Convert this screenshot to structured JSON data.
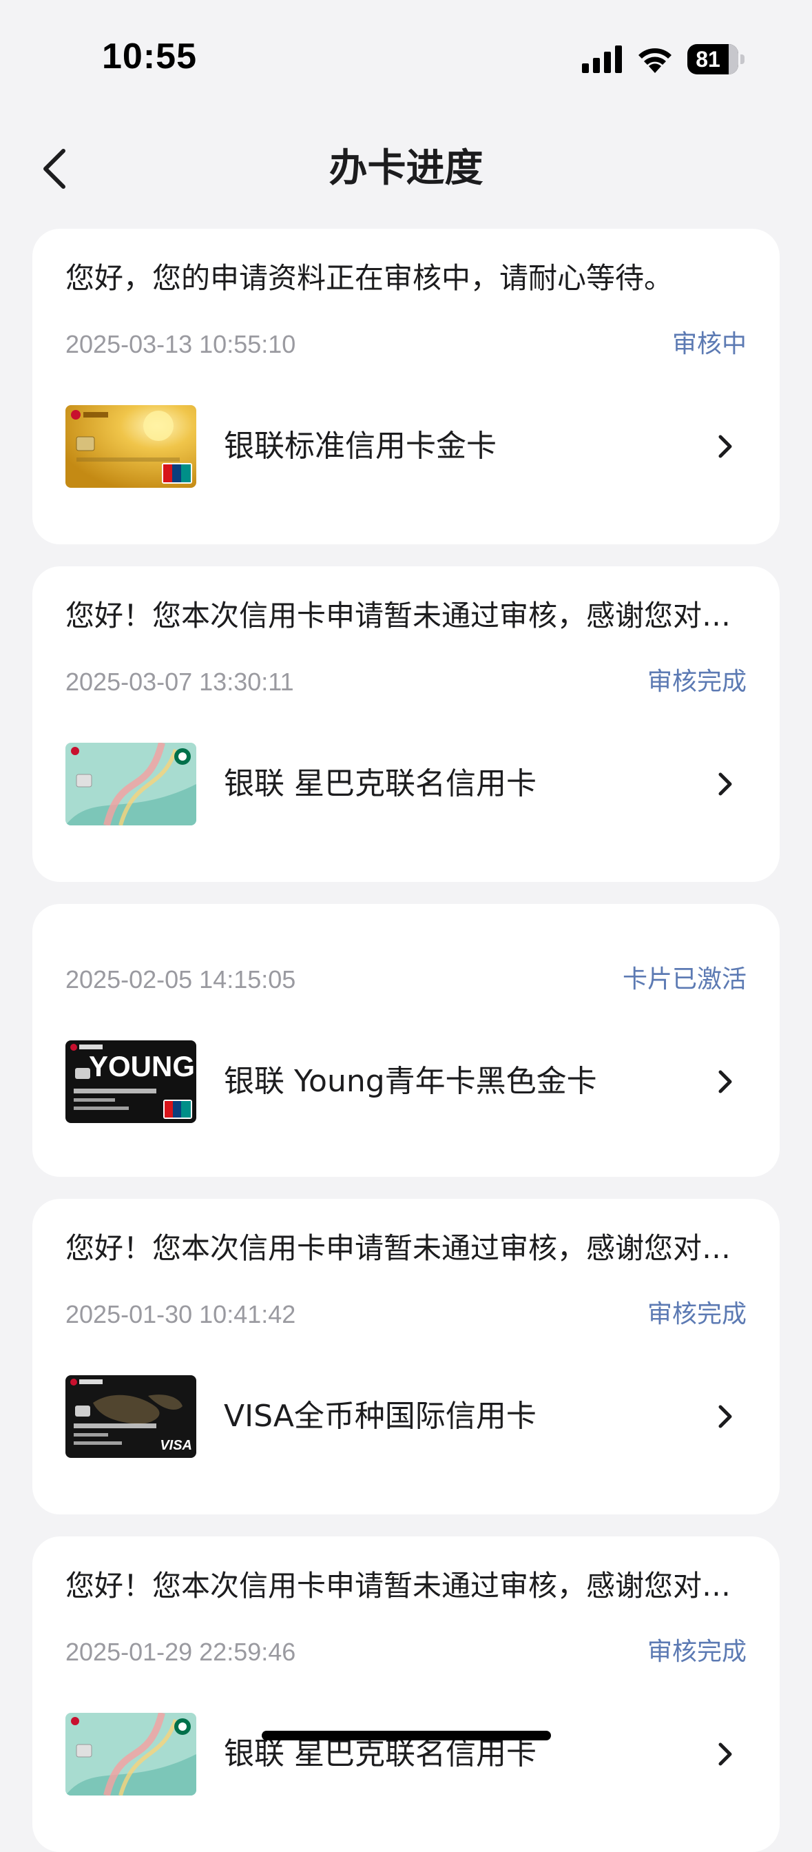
{
  "status_bar": {
    "time": "10:55",
    "battery": "81",
    "battery_level": 0.81
  },
  "nav": {
    "title": "办卡进度"
  },
  "applications": [
    {
      "message": "您好，您的申请资料正在审核中，请耐心等待。",
      "date": "2025-03-13 10:55:10",
      "status": "审核中",
      "card_name": "银联标准信用卡金卡",
      "card_style": "gold"
    },
    {
      "message": "您好！您本次信用卡申请暂未通过审核，感谢您对招商银行的支持。",
      "date": "2025-03-07 13:30:11",
      "status": "审核完成",
      "card_name": "银联 星巴克联名信用卡",
      "card_style": "starbucks"
    },
    {
      "message": "",
      "date": "2025-02-05 14:15:05",
      "status": "卡片已激活",
      "card_name": "银联 Young青年卡黑色金卡",
      "card_style": "young"
    },
    {
      "message": "您好！您本次信用卡申请暂未通过审核，感谢您对招商银行的支持。",
      "date": "2025-01-30 10:41:42",
      "status": "审核完成",
      "card_name": "VISA全币种国际信用卡",
      "card_style": "visa"
    },
    {
      "message": "您好！您本次信用卡申请暂未通过审核，感谢您对招商银行的支持。",
      "date": "2025-01-29 22:59:46",
      "status": "审核完成",
      "card_name": "银联 星巴克联名信用卡",
      "card_style": "starbucks"
    }
  ],
  "card_art": {
    "young_text": "YOUNG",
    "visa_text": "VISA"
  }
}
